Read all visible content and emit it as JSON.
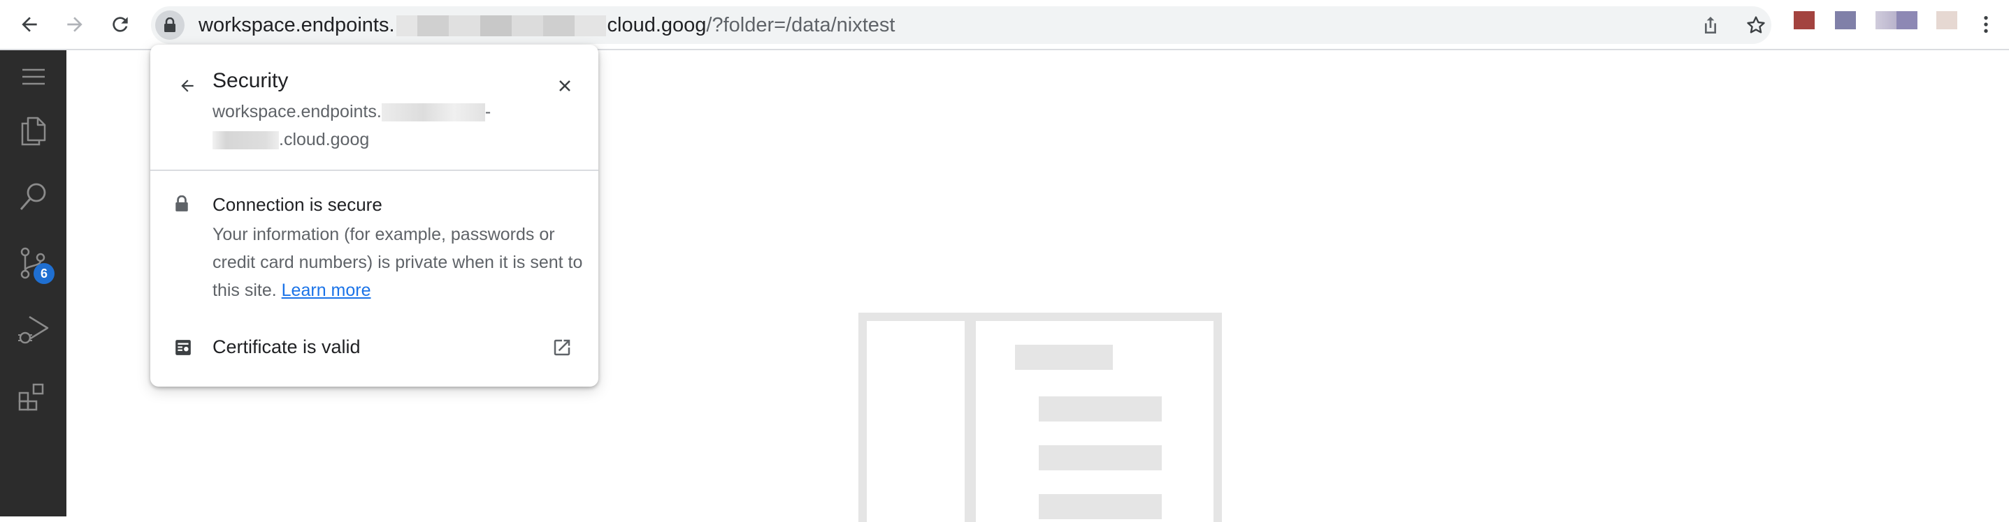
{
  "browser": {
    "url_main": "workspace.endpoints.",
    "url_domain_end": "cloud.goog",
    "url_path": "/?folder=/data/nixtest",
    "icons": [
      "back-icon",
      "forward-icon",
      "reload-icon",
      "lock-icon",
      "share-icon",
      "star-icon",
      "more-vert-icon"
    ],
    "extension_colors": [
      "#a3433f",
      "#8080a8",
      "#b9b3cc",
      "#8d88b4",
      "#e6d8d2"
    ]
  },
  "security_popup": {
    "title": "Security",
    "domain_line1_start": "workspace.endpoints.",
    "domain_line1_end": "-",
    "domain_line2_end": ".cloud.goog",
    "connection_title": "Connection is secure",
    "connection_desc": "Your information (for example, passwords or credit card numbers) is private when it is sent to this site.",
    "learn_more": "Learn more",
    "certificate": "Certificate is valid"
  },
  "activity_bar": {
    "items": [
      "menu-icon",
      "explorer-icon",
      "search-icon",
      "source-control-icon",
      "run-debug-icon",
      "extensions-icon"
    ],
    "source_control_badge": "6"
  },
  "colors": {
    "activity_bg": "#2c2c2c",
    "badge": "#1f6fd1",
    "link": "#1a73e8",
    "placeholder": "#e5e5e5"
  }
}
